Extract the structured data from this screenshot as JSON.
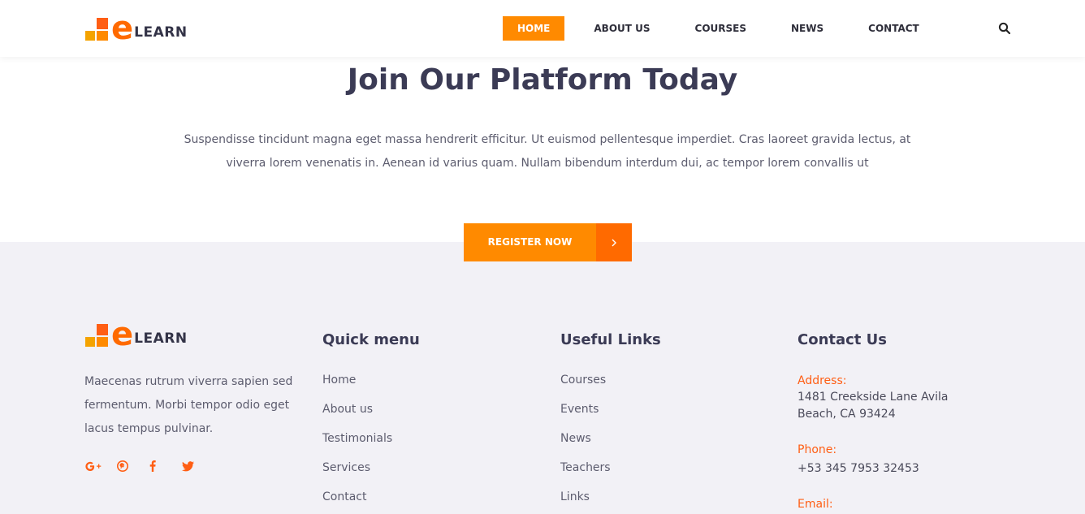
{
  "header": {
    "logo_word": "LEARN",
    "logo_letter": "e",
    "nav": [
      {
        "label": "HOME",
        "active": true
      },
      {
        "label": "ABOUT US",
        "active": false
      },
      {
        "label": "COURSES",
        "active": false
      },
      {
        "label": "NEWS",
        "active": false
      },
      {
        "label": "CONTACT",
        "active": false
      }
    ],
    "search_icon": "search-icon"
  },
  "hero": {
    "title": "Join Our Platform Today",
    "text": "Suspendisse tincidunt magna eget massa hendrerit efficitur. Ut euismod pellentesque imperdiet. Cras laoreet gravida lectus, at viverra lorem venenatis in. Aenean id varius quam. Nullam bibendum interdum dui, ac tempor lorem convallis ut",
    "cta_label": "REGISTER NOW"
  },
  "footer": {
    "about": {
      "logo_letter": "e",
      "logo_word": "LEARN",
      "text": "Maecenas rutrum viverra sapien sed fermentum. Morbi tempor odio eget lacus tempus pulvinar.",
      "socials": [
        "google-plus-icon",
        "pinterest-icon",
        "facebook-icon",
        "twitter-icon"
      ]
    },
    "quick_menu": {
      "title": "Quick menu",
      "items": [
        "Home",
        "About us",
        "Testimonials",
        "Services",
        "Contact"
      ]
    },
    "useful_links": {
      "title": "Useful Links",
      "items": [
        "Courses",
        "Events",
        "News",
        "Teachers",
        "Links"
      ]
    },
    "contact": {
      "title": "Contact Us",
      "address_label": "Address:",
      "address_line1": "1481 Creekside Lane Avila",
      "address_line2": "Beach, CA 93424",
      "phone_label": "Phone:",
      "phone": "+53 345 7953 32453",
      "email_label": "Email:"
    }
  },
  "colors": {
    "accent_orange": "#ff8a00",
    "accent_deep": "#ff6a00",
    "footer_bg": "#f2f1f6",
    "heading": "#3b3b55"
  }
}
